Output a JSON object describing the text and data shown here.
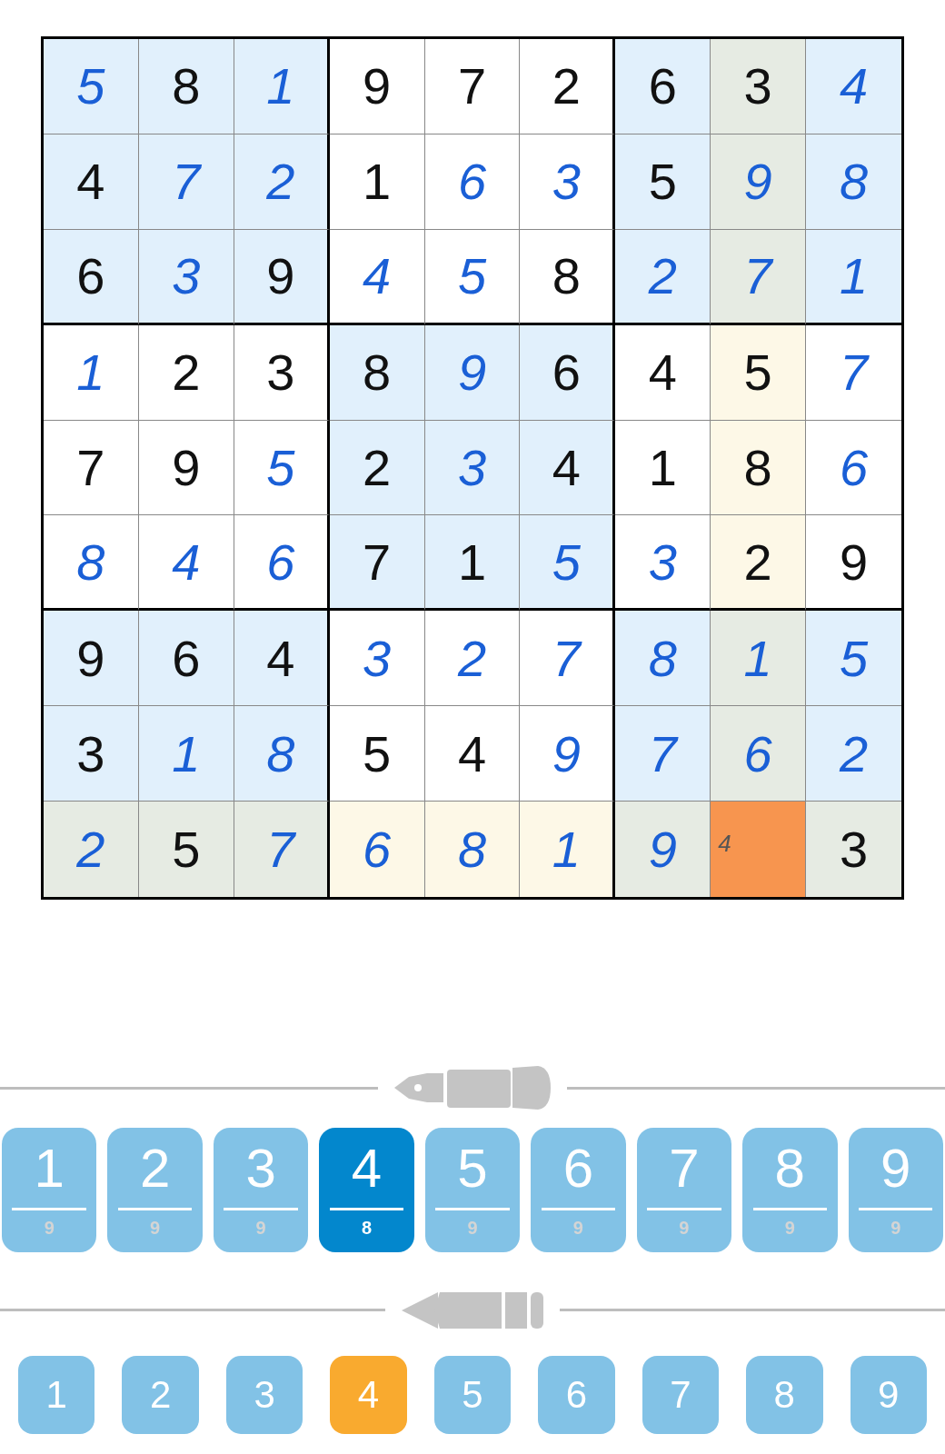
{
  "grid": [
    [
      {
        "value": "5",
        "kind": "entered",
        "selected": false
      },
      {
        "value": "8",
        "kind": "given",
        "selected": false
      },
      {
        "value": "1",
        "kind": "entered",
        "selected": false
      },
      {
        "value": "9",
        "kind": "given",
        "selected": false
      },
      {
        "value": "7",
        "kind": "given",
        "selected": false
      },
      {
        "value": "2",
        "kind": "given",
        "selected": false
      },
      {
        "value": "6",
        "kind": "given",
        "selected": false
      },
      {
        "value": "3",
        "kind": "given",
        "selected": false
      },
      {
        "value": "4",
        "kind": "entered",
        "selected": false
      }
    ],
    [
      {
        "value": "4",
        "kind": "given",
        "selected": false
      },
      {
        "value": "7",
        "kind": "entered",
        "selected": false
      },
      {
        "value": "2",
        "kind": "entered",
        "selected": false
      },
      {
        "value": "1",
        "kind": "given",
        "selected": false
      },
      {
        "value": "6",
        "kind": "entered",
        "selected": false
      },
      {
        "value": "3",
        "kind": "entered",
        "selected": false
      },
      {
        "value": "5",
        "kind": "given",
        "selected": false
      },
      {
        "value": "9",
        "kind": "entered",
        "selected": false
      },
      {
        "value": "8",
        "kind": "entered",
        "selected": false
      }
    ],
    [
      {
        "value": "6",
        "kind": "given",
        "selected": false
      },
      {
        "value": "3",
        "kind": "entered",
        "selected": false
      },
      {
        "value": "9",
        "kind": "given",
        "selected": false
      },
      {
        "value": "4",
        "kind": "entered",
        "selected": false
      },
      {
        "value": "5",
        "kind": "entered",
        "selected": false
      },
      {
        "value": "8",
        "kind": "given",
        "selected": false
      },
      {
        "value": "2",
        "kind": "entered",
        "selected": false
      },
      {
        "value": "7",
        "kind": "entered",
        "selected": false
      },
      {
        "value": "1",
        "kind": "entered",
        "selected": false
      }
    ],
    [
      {
        "value": "1",
        "kind": "entered",
        "selected": false
      },
      {
        "value": "2",
        "kind": "given",
        "selected": false
      },
      {
        "value": "3",
        "kind": "given",
        "selected": false
      },
      {
        "value": "8",
        "kind": "given",
        "selected": false
      },
      {
        "value": "9",
        "kind": "entered",
        "selected": false
      },
      {
        "value": "6",
        "kind": "given",
        "selected": false
      },
      {
        "value": "4",
        "kind": "given",
        "selected": false
      },
      {
        "value": "5",
        "kind": "given",
        "selected": false
      },
      {
        "value": "7",
        "kind": "entered",
        "selected": false
      }
    ],
    [
      {
        "value": "7",
        "kind": "given",
        "selected": false
      },
      {
        "value": "9",
        "kind": "given",
        "selected": false
      },
      {
        "value": "5",
        "kind": "entered",
        "selected": false
      },
      {
        "value": "2",
        "kind": "given",
        "selected": false
      },
      {
        "value": "3",
        "kind": "entered",
        "selected": false
      },
      {
        "value": "4",
        "kind": "given",
        "selected": false
      },
      {
        "value": "1",
        "kind": "given",
        "selected": false
      },
      {
        "value": "8",
        "kind": "given",
        "selected": false
      },
      {
        "value": "6",
        "kind": "entered",
        "selected": false
      }
    ],
    [
      {
        "value": "8",
        "kind": "entered",
        "selected": false
      },
      {
        "value": "4",
        "kind": "entered",
        "selected": false
      },
      {
        "value": "6",
        "kind": "entered",
        "selected": false
      },
      {
        "value": "7",
        "kind": "given",
        "selected": false
      },
      {
        "value": "1",
        "kind": "given",
        "selected": false
      },
      {
        "value": "5",
        "kind": "entered",
        "selected": false
      },
      {
        "value": "3",
        "kind": "entered",
        "selected": false
      },
      {
        "value": "2",
        "kind": "given",
        "selected": false
      },
      {
        "value": "9",
        "kind": "given",
        "selected": false
      }
    ],
    [
      {
        "value": "9",
        "kind": "given",
        "selected": false
      },
      {
        "value": "6",
        "kind": "given",
        "selected": false
      },
      {
        "value": "4",
        "kind": "given",
        "selected": false
      },
      {
        "value": "3",
        "kind": "entered",
        "selected": false
      },
      {
        "value": "2",
        "kind": "entered",
        "selected": false
      },
      {
        "value": "7",
        "kind": "entered",
        "selected": false
      },
      {
        "value": "8",
        "kind": "entered",
        "selected": false
      },
      {
        "value": "1",
        "kind": "entered",
        "selected": false
      },
      {
        "value": "5",
        "kind": "entered",
        "selected": false
      }
    ],
    [
      {
        "value": "3",
        "kind": "given",
        "selected": false
      },
      {
        "value": "1",
        "kind": "entered",
        "selected": false
      },
      {
        "value": "8",
        "kind": "entered",
        "selected": false
      },
      {
        "value": "5",
        "kind": "given",
        "selected": false
      },
      {
        "value": "4",
        "kind": "given",
        "selected": false
      },
      {
        "value": "9",
        "kind": "entered",
        "selected": false
      },
      {
        "value": "7",
        "kind": "entered",
        "selected": false
      },
      {
        "value": "6",
        "kind": "entered",
        "selected": false
      },
      {
        "value": "2",
        "kind": "entered",
        "selected": false
      }
    ],
    [
      {
        "value": "2",
        "kind": "entered",
        "selected": false
      },
      {
        "value": "5",
        "kind": "given",
        "selected": false
      },
      {
        "value": "7",
        "kind": "entered",
        "selected": false
      },
      {
        "value": "6",
        "kind": "entered",
        "selected": false
      },
      {
        "value": "8",
        "kind": "entered",
        "selected": false
      },
      {
        "value": "1",
        "kind": "entered",
        "selected": false
      },
      {
        "value": "9",
        "kind": "entered",
        "selected": false
      },
      {
        "value": "4",
        "kind": "note",
        "selected": true
      },
      {
        "value": "3",
        "kind": "given",
        "selected": false
      }
    ]
  ],
  "pen_keys": [
    {
      "label": "1",
      "count": "9",
      "selected": false
    },
    {
      "label": "2",
      "count": "9",
      "selected": false
    },
    {
      "label": "3",
      "count": "9",
      "selected": false
    },
    {
      "label": "4",
      "count": "8",
      "selected": true
    },
    {
      "label": "5",
      "count": "9",
      "selected": false
    },
    {
      "label": "6",
      "count": "9",
      "selected": false
    },
    {
      "label": "7",
      "count": "9",
      "selected": false
    },
    {
      "label": "8",
      "count": "9",
      "selected": false
    },
    {
      "label": "9",
      "count": "9",
      "selected": false
    }
  ],
  "pencil_keys": [
    {
      "label": "1",
      "selected": false
    },
    {
      "label": "2",
      "selected": false
    },
    {
      "label": "3",
      "selected": false
    },
    {
      "label": "4",
      "selected": true
    },
    {
      "label": "5",
      "selected": false
    },
    {
      "label": "6",
      "selected": false
    },
    {
      "label": "7",
      "selected": false
    },
    {
      "label": "8",
      "selected": false
    },
    {
      "label": "9",
      "selected": false
    }
  ]
}
